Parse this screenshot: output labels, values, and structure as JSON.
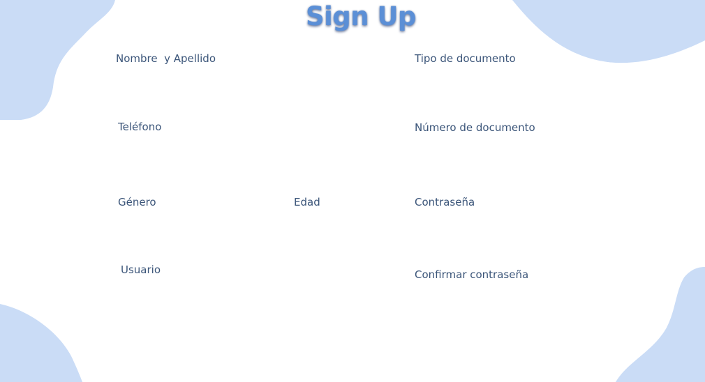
{
  "title": "Sign Up",
  "fields": {
    "full_name": "Nombre  y Apellido",
    "document_type": "Tipo de documento",
    "phone": "Teléfono",
    "document_number": "Número de documento",
    "gender": "Género",
    "age": "Edad",
    "password": "Contraseña",
    "username": "Usuario",
    "confirm_password": "Confirmar contraseña"
  },
  "colors": {
    "blob": "#cadcf6",
    "title": "#5b8fd6",
    "label": "#3b5579"
  }
}
